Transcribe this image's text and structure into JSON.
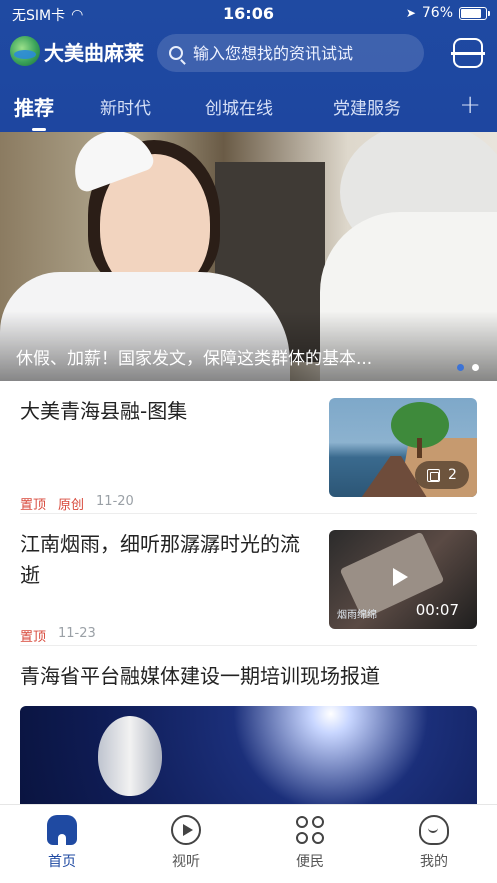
{
  "status_bar": {
    "carrier": "无SIM卡",
    "time": "16:06",
    "battery": "76%"
  },
  "header": {
    "app_name": "大美曲麻莱",
    "search_placeholder": "输入您想找的资讯试试"
  },
  "tabs": [
    {
      "label": "推荐",
      "active": true
    },
    {
      "label": "新时代",
      "active": false
    },
    {
      "label": "创城在线",
      "active": false
    },
    {
      "label": "党建服务",
      "active": false
    }
  ],
  "tab_add": "+",
  "banner": {
    "caption": "休假、加薪！国家发文，保障这类群体的基本...",
    "slide_count": 2,
    "active_slide": 2
  },
  "articles": [
    {
      "title": "大美青海县融-图集",
      "tags": [
        "置顶",
        "原创"
      ],
      "date": "11-20",
      "media": {
        "type": "gallery",
        "count": "2"
      }
    },
    {
      "title": "江南烟雨，细听那潺潺时光的流逝",
      "tags": [
        "置顶"
      ],
      "date": "11-23",
      "media": {
        "type": "video",
        "duration": "00:07",
        "watermark": "烟雨绵绵"
      }
    },
    {
      "title": "青海省平台融媒体建设一期培训现场报道",
      "tags": [],
      "date": "",
      "media": {
        "type": "image"
      }
    }
  ],
  "bottom_nav": [
    {
      "label": "首页",
      "icon": "home-icon",
      "active": true
    },
    {
      "label": "视听",
      "icon": "play-circle-icon",
      "active": false
    },
    {
      "label": "便民",
      "icon": "grid-icon",
      "active": false
    },
    {
      "label": "我的",
      "icon": "user-icon",
      "active": false
    }
  ],
  "colors": {
    "brand_blue": "#1f4aa2",
    "tag_red": "#d84a3c",
    "date_gray": "#9aa0a6"
  }
}
